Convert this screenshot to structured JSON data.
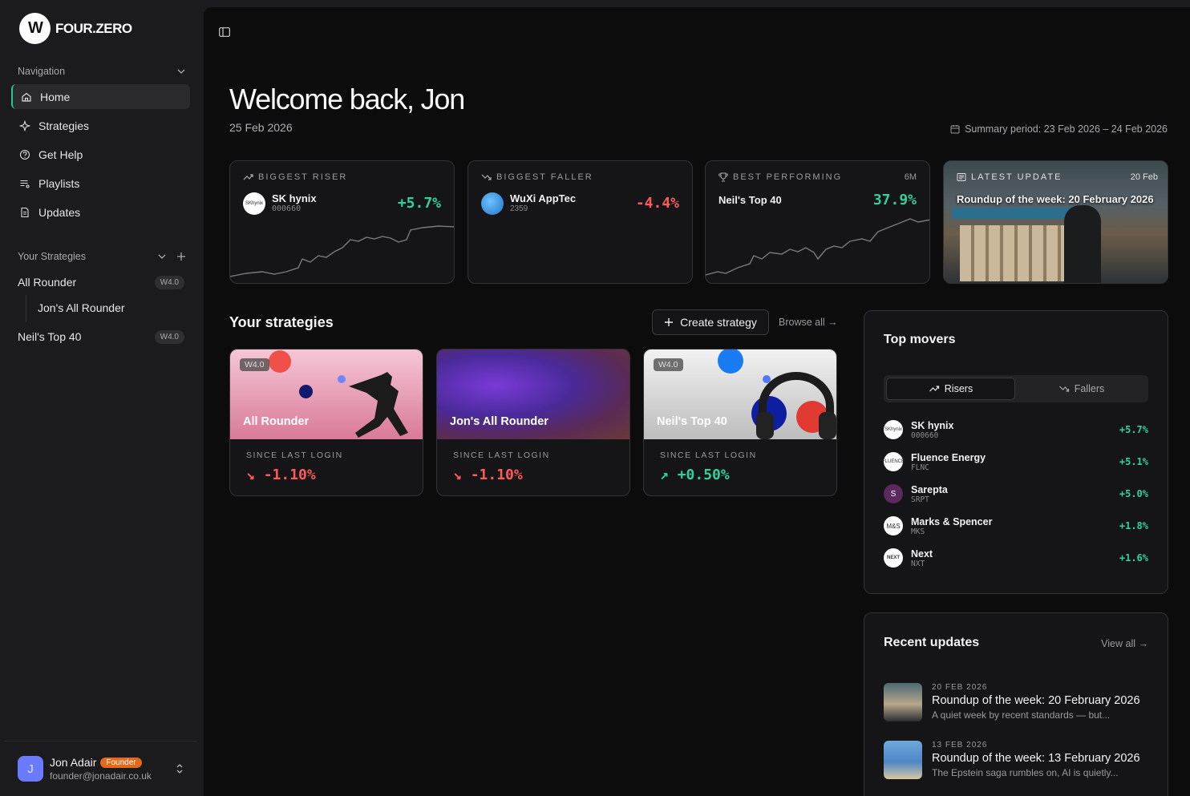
{
  "brand": {
    "name": "FOUR.ZERO",
    "mark": "W"
  },
  "nav": {
    "header": "Navigation",
    "items": [
      {
        "label": "Home",
        "icon": "home-icon",
        "active": true
      },
      {
        "label": "Strategies",
        "icon": "sparkle-icon"
      },
      {
        "label": "Get Help",
        "icon": "help-circle-icon"
      },
      {
        "label": "Playlists",
        "icon": "playlist-icon"
      },
      {
        "label": "Updates",
        "icon": "document-icon"
      }
    ]
  },
  "your_strategies": {
    "header": "Your Strategies",
    "items": [
      {
        "label": "All Rounder",
        "badge": "W4.0"
      },
      {
        "label": "Jon's All Rounder",
        "badge": ""
      },
      {
        "label": "Neil's Top 40",
        "badge": "W4.0"
      }
    ]
  },
  "user": {
    "name": "Jon Adair",
    "role": "Founder",
    "email": "founder@jonadair.co.uk",
    "initial": "J"
  },
  "header": {
    "greeting": "Welcome back, Jon",
    "date": "25 Feb 2026",
    "summary": "Summary period: 23 Feb 2026 – 24 Feb 2026"
  },
  "kpis": {
    "riser": {
      "label": "BIGGEST RISER",
      "name": "SK hynix",
      "ticker": "000660",
      "value": "+5.7%"
    },
    "faller": {
      "label": "BIGGEST FALLER",
      "name": "WuXi AppTec",
      "ticker": "2359",
      "value": "-4.4%"
    },
    "best": {
      "label": "BEST PERFORMING",
      "period": "6M",
      "name": "Neil's Top 40",
      "value": "37.9%"
    },
    "latest": {
      "label": "LATEST UPDATE",
      "date": "20 Feb",
      "title": "Roundup of the week: 20 February 2026"
    }
  },
  "strategies": {
    "title": "Your strategies",
    "create": "Create strategy",
    "browse": "Browse all →",
    "since": "SINCE LAST LOGIN",
    "cards": [
      {
        "name": "All Rounder",
        "badge": "W4.0",
        "value": "-1.10%",
        "dir": "down"
      },
      {
        "name": "Jon's All Rounder",
        "badge": "",
        "value": "-1.10%",
        "dir": "down"
      },
      {
        "name": "Neil's Top 40",
        "badge": "W4.0",
        "value": "+0.50%",
        "dir": "up"
      }
    ]
  },
  "movers": {
    "title": "Top movers",
    "tab_risers": "Risers",
    "tab_fallers": "Fallers",
    "items": [
      {
        "name": "SK hynix",
        "ticker": "000660",
        "value": "+5.7%",
        "logo": "SKhynix"
      },
      {
        "name": "Fluence Energy",
        "ticker": "FLNC",
        "value": "+5.1%",
        "logo": "FLUENCE"
      },
      {
        "name": "Sarepta",
        "ticker": "SRPT",
        "value": "+5.0%",
        "logo": "S"
      },
      {
        "name": "Marks & Spencer",
        "ticker": "MKS",
        "value": "+1.8%",
        "logo": "M&S"
      },
      {
        "name": "Next",
        "ticker": "NXT",
        "value": "+1.6%",
        "logo": "NEXT"
      }
    ]
  },
  "updates": {
    "title": "Recent updates",
    "view_all": "View all →",
    "items": [
      {
        "date": "20 FEB 2026",
        "title": "Roundup of the week: 20 February 2026",
        "sub": "A quiet week by recent standards — but..."
      },
      {
        "date": "13 FEB 2026",
        "title": "Roundup of the week: 13 February 2026",
        "sub": "The Epstein saga rumbles on, AI is quietly..."
      }
    ]
  },
  "colors": {
    "accent_green": "#30d29a",
    "accent_red": "#ff5a5a",
    "founder_badge": "#e36a1a"
  }
}
